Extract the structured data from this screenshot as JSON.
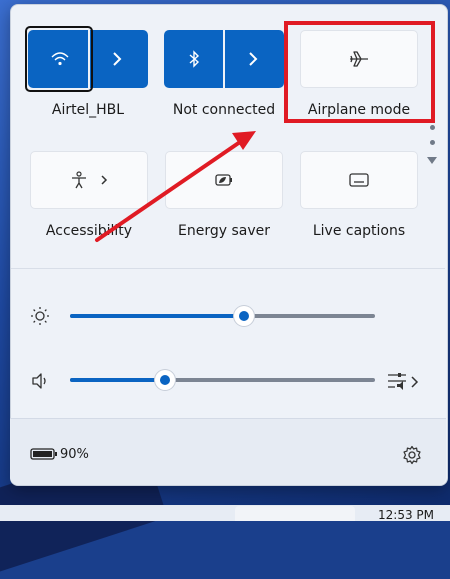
{
  "quick_settings": {
    "tiles": {
      "wifi": {
        "label": "Airtel_HBL",
        "state": "on",
        "icon": "wifi-icon"
      },
      "bluetooth": {
        "label": "Not connected",
        "state": "on",
        "icon": "bluetooth-icon"
      },
      "airplane": {
        "label": "Airplane mode",
        "state": "off",
        "icon": "airplane-icon"
      },
      "accessibility": {
        "label": "Accessibility",
        "icon": "accessibility-icon"
      },
      "energy_saver": {
        "label": "Energy saver",
        "icon": "energy-saver-icon"
      },
      "live_captions": {
        "label": "Live captions",
        "icon": "captions-icon"
      }
    },
    "brightness": {
      "icon": "sun-icon",
      "level": 0.57
    },
    "volume": {
      "icon": "speaker-icon",
      "level": 0.31,
      "mixer_icon": "audio-mixer-icon"
    },
    "battery": {
      "icon": "battery-icon",
      "percent_text": "90%"
    },
    "settings_icon": "gear-icon"
  },
  "taskbar": {
    "clock_text": "12:53 PM"
  },
  "colors": {
    "accent": "#0a64c2",
    "annotation": "#e01b24"
  }
}
